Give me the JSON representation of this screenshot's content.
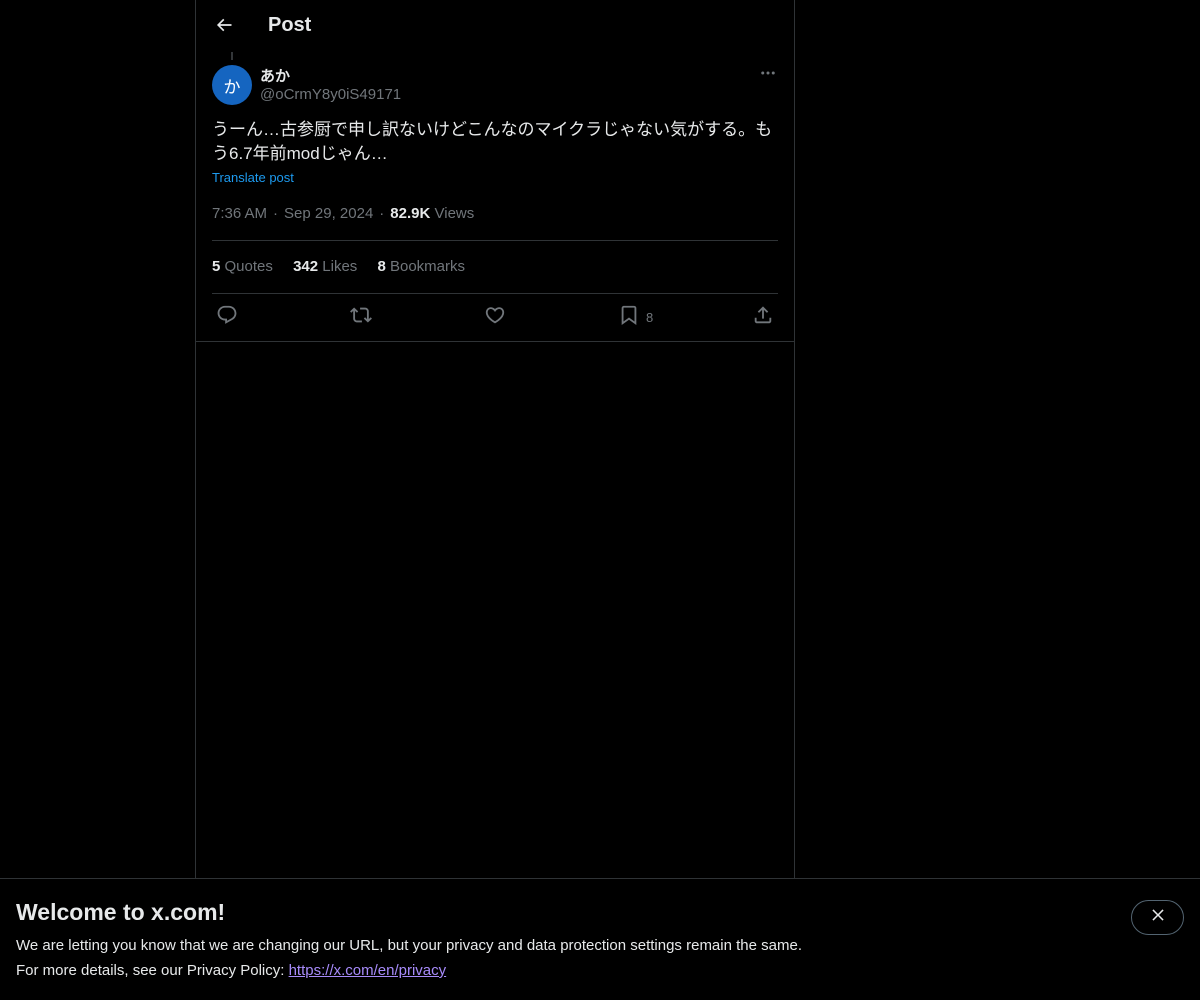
{
  "header": {
    "title": "Post",
    "back_icon": "arrow-left-icon"
  },
  "post": {
    "author": {
      "avatar_initial": "か",
      "avatar_color": "#1565c0",
      "display_name": "あか",
      "handle": "@oCrmY8y0iS49171"
    },
    "text": "うーん…古参厨で申し訳ないけどこんなのマイクラじゃない気がする。もう6.7年前modじゃん…",
    "translate_label": "Translate post",
    "time": "7:36 AM",
    "date": "Sep 29, 2024",
    "views_count": "82.9K",
    "views_label": "Views",
    "separator": "·"
  },
  "stats": {
    "quotes_count": "5",
    "quotes_label": "Quotes",
    "likes_count": "342",
    "likes_label": "Likes",
    "bookmarks_count": "8",
    "bookmarks_label": "Bookmarks"
  },
  "actions": {
    "reply_icon": "reply-icon",
    "repost_icon": "repost-icon",
    "like_icon": "heart-icon",
    "bookmark_icon": "bookmark-icon",
    "bookmark_count": "8",
    "share_icon": "share-icon"
  },
  "banner": {
    "title": "Welcome to x.com!",
    "line1": "We are letting you know that we are changing our URL, but your privacy and data protection settings remain the same.",
    "line2_prefix": "For more details, see our Privacy Policy: ",
    "link_text": "https://x.com/en/privacy",
    "close_icon": "close-icon"
  },
  "colors": {
    "background": "#000000",
    "text_primary": "#e7e9ea",
    "text_secondary": "#71767b",
    "accent": "#1d9bf0",
    "border": "#2f3336",
    "link_visited": "#a78bfa"
  }
}
